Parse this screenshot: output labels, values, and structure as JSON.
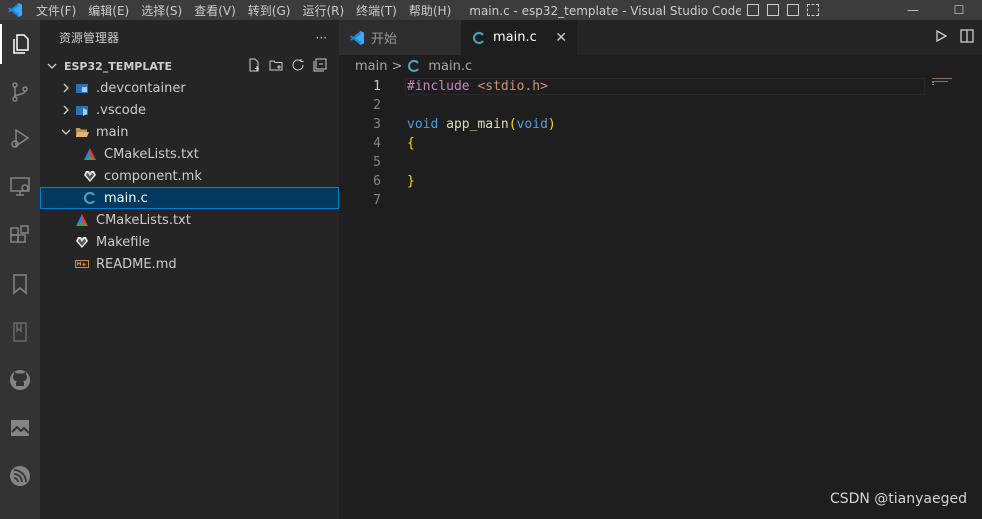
{
  "titlebar": {
    "menu": [
      "文件(F)",
      "编辑(E)",
      "选择(S)",
      "查看(V)",
      "转到(G)",
      "运行(R)",
      "终端(T)",
      "帮助(H)"
    ],
    "window_title": "main.c - esp32_template - Visual Studio Code [管..."
  },
  "explorer": {
    "header": "资源管理器",
    "more": "···",
    "section_title": "ESP32_TEMPLATE",
    "items": [
      {
        "label": ".devcontainer",
        "type": "folder",
        "expanded": false
      },
      {
        "label": ".vscode",
        "type": "folder",
        "expanded": false
      },
      {
        "label": "main",
        "type": "folder",
        "expanded": true
      },
      {
        "label": "CMakeLists.txt",
        "type": "cmake"
      },
      {
        "label": "component.mk",
        "type": "make"
      },
      {
        "label": "main.c",
        "type": "c",
        "selected": true
      },
      {
        "label": "CMakeLists.txt",
        "type": "cmake"
      },
      {
        "label": "Makefile",
        "type": "make"
      },
      {
        "label": "README.md",
        "type": "markdown"
      }
    ]
  },
  "tabs": [
    {
      "label": "开始",
      "active": false
    },
    {
      "label": "main.c",
      "active": true,
      "close": "✕"
    }
  ],
  "breadcrumb": {
    "folder": "main",
    "sep": ">",
    "file": "main.c"
  },
  "code": {
    "line_numbers": [
      "1",
      "2",
      "3",
      "4",
      "5",
      "6",
      "7"
    ],
    "l1_directive": "#include",
    "l1_header": "<stdio.h>",
    "l3_type": "void",
    "l3_name": "app_main",
    "l3_open": "(",
    "l3_param": "void",
    "l3_close": ")",
    "l4": "{",
    "l6": "}"
  },
  "watermark": "CSDN @tianyaeged",
  "colors": {
    "accent": "#007fd4",
    "cmake": "#e53935",
    "c_icon": "#519aba"
  }
}
